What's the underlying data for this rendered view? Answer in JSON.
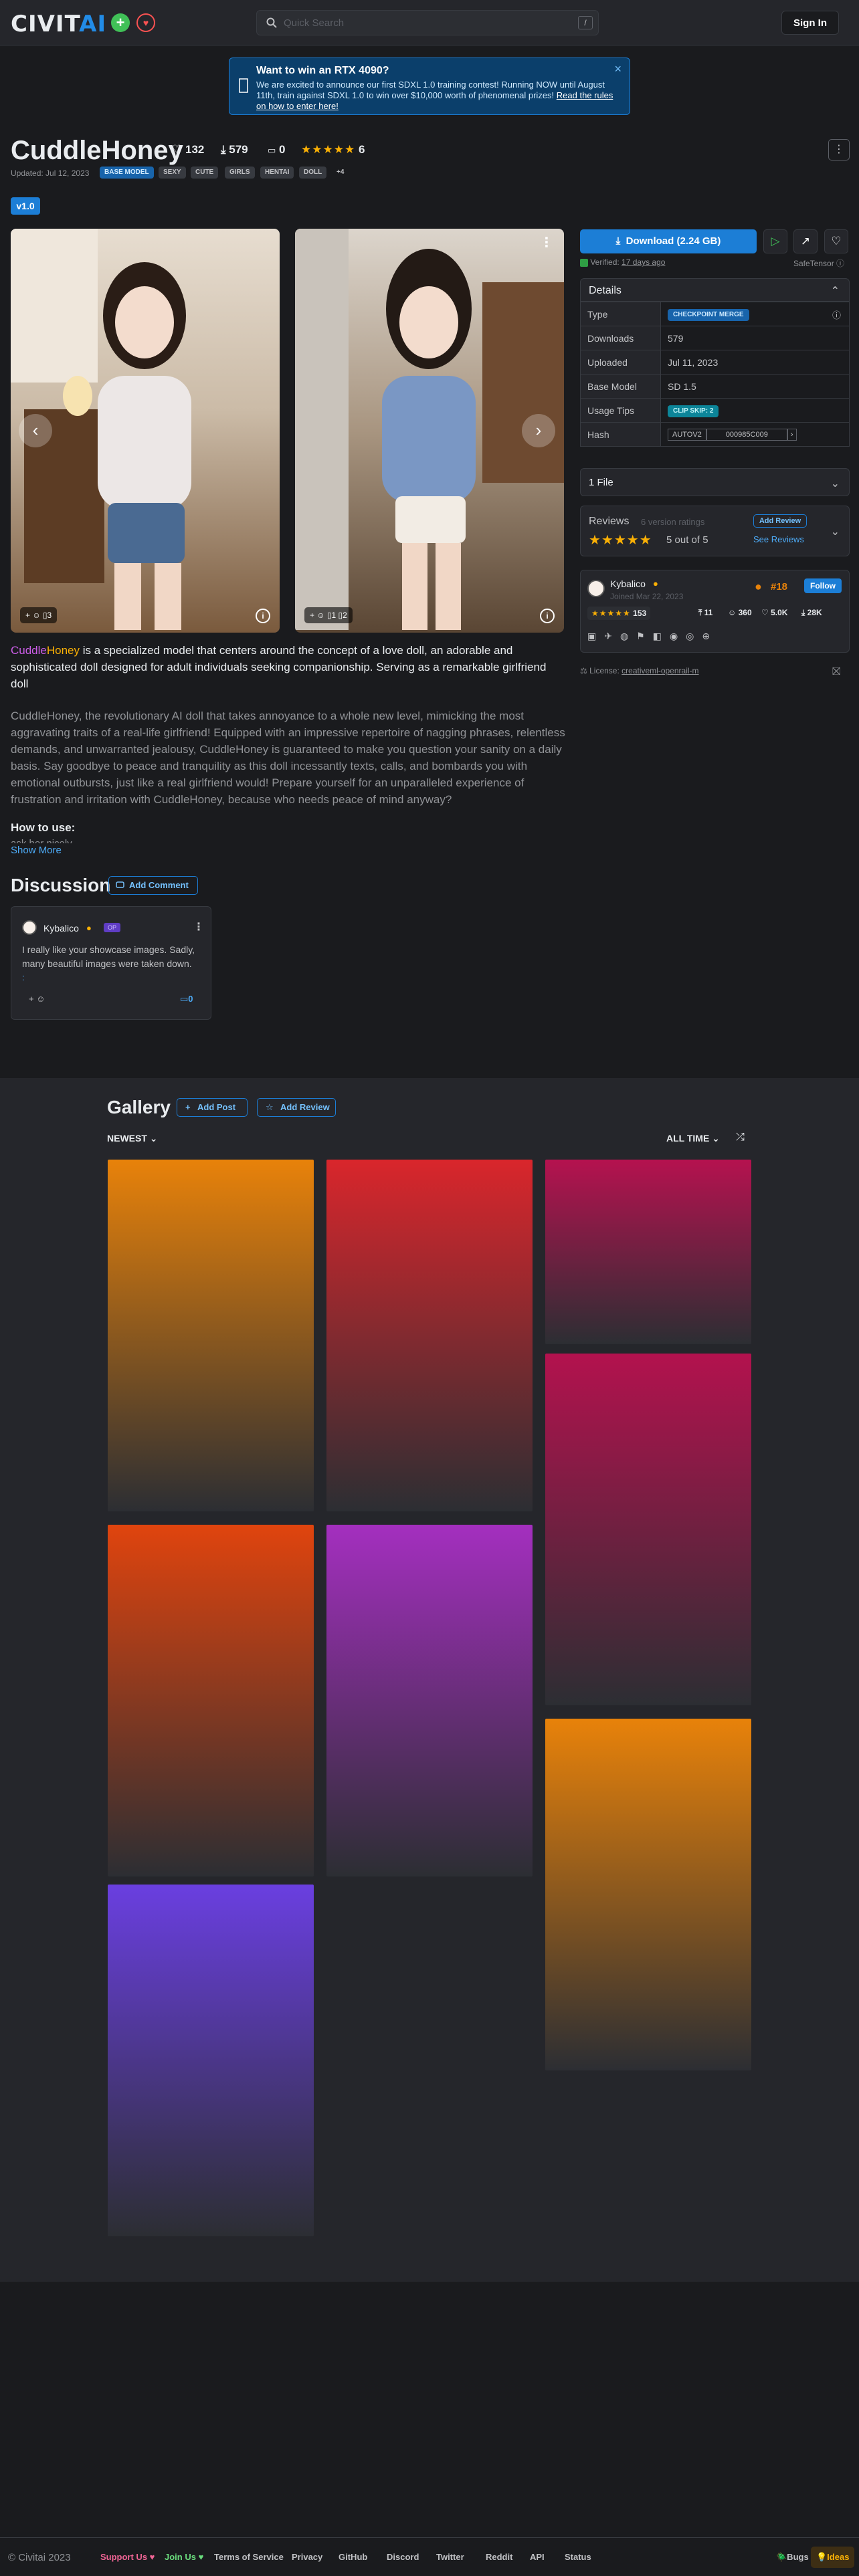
{
  "header": {
    "logo_main": "CIVIT",
    "logo_accent": "AI",
    "search_placeholder": "Quick Search",
    "search_shortcut": "/",
    "signin": "Sign In"
  },
  "alert": {
    "title": "Want to win an RTX 4090?",
    "message": "We are excited to announce our first SDXL 1.0 training contest! Running NOW until August 11th, train against SDXL 1.0 to win over $10,000 worth of phenomenal prizes!",
    "link": "Read the rules on how to enter here!",
    "close": "×"
  },
  "model": {
    "title": "CuddleHoney",
    "likes": "132",
    "downloads": "579",
    "comments": "0",
    "rating_count": "6",
    "updated": "Updated: Jul 12, 2023",
    "tags": [
      "BASE MODEL",
      "SEXY",
      "CUTE",
      "GIRLS",
      "HENTAI",
      "DOLL",
      "+4"
    ],
    "version": "v1.0",
    "stars": "★★★★★"
  },
  "images": [
    {
      "reactions": "+ ☺",
      "comments": "▯3",
      "colors": [
        "#d8cfc4",
        "#6b4e36"
      ]
    },
    {
      "reactions": "+ ☺",
      "comments": "▯1 ▯2",
      "colors": [
        "#b9b2aa",
        "#5a4634"
      ]
    }
  ],
  "description": {
    "lead_name_a": "Cuddle",
    "lead_name_b": "Honey",
    "lead_rest": " is a specialized model that centers around the concept of a love doll, an adorable and sophisticated doll designed for adult individuals seeking companionship. Serving as a remarkable girlfriend doll",
    "body": "CuddleHoney, the revolutionary AI doll that takes annoyance to a whole new level, mimicking the most aggravating traits of a real-life girlfriend! Equipped with an impressive repertoire of nagging phrases, relentless demands, and unwarranted jealousy, CuddleHoney is guaranteed to make you question your sanity on a daily basis. Say goodbye to peace and tranquility as this doll incessantly texts, calls, and bombards you with emotional outbursts, just like a real girlfriend would! Prepare yourself for an unparalleled experience of frustration and irritation with CuddleHoney, because who needs peace of mind anyway?",
    "howto_title": "How to use:",
    "howto_text": "ask her nicely",
    "show_more": "Show More"
  },
  "discussion": {
    "title": "Discussion",
    "add_comment": "Add Comment",
    "comment": {
      "user": "Kybalico",
      "badge": "OP",
      "text": "I really like your showcase images. Sadly, many beautiful images were taken down.",
      "ellipsis": ":",
      "reply_count": "0"
    }
  },
  "sidebar": {
    "download": "Download (2.24 GB)",
    "verified": "Verified:",
    "verified_when": "17 days ago",
    "safetensor": "SafeTensor",
    "details_title": "Details",
    "details": [
      {
        "key": "Type",
        "value": "CHECKPOINT MERGE"
      },
      {
        "key": "Downloads",
        "value": "579"
      },
      {
        "key": "Uploaded",
        "value": "Jul 11, 2023"
      },
      {
        "key": "Base Model",
        "value": "SD 1.5"
      },
      {
        "key": "Usage Tips",
        "value": "CLIP SKIP: 2"
      },
      {
        "key": "Hash",
        "value_a": "AUTOV2",
        "value_b": "000985C009"
      }
    ],
    "files": "1 File",
    "reviews": {
      "title": "Reviews",
      "sub": "6 version ratings",
      "stars": "★★★★★",
      "score": "5 out of 5",
      "add": "Add Review",
      "see": "See Reviews"
    },
    "creator": {
      "name": "Kybalico",
      "joined": "Joined Mar 22, 2023",
      "rank": "#18",
      "follow": "Follow",
      "rating": "153",
      "stats": [
        "11",
        "360",
        "5.0K",
        "28K"
      ]
    },
    "license": "License:",
    "license_link": "creativeml-openrail-m"
  },
  "gallery": {
    "title": "Gallery",
    "add_post": "Add Post",
    "add_review": "Add Review",
    "sort": "NEWEST",
    "period": "ALL TIME",
    "tiles": [
      {
        "color": "#e8820a"
      },
      {
        "color": "#d9262c"
      },
      {
        "color": "#b5124f"
      },
      {
        "color": "#b3124e"
      },
      {
        "color": "#e0440e"
      },
      {
        "color": "#a42fbf"
      },
      {
        "color": "#e8820a"
      },
      {
        "color": "#6a3fe0"
      }
    ]
  },
  "footer": {
    "copyright": "© Civitai 2023",
    "links": [
      "Support Us ♥",
      "Join Us ♥",
      "Terms of Service",
      "Privacy",
      "GitHub",
      "Discord",
      "Twitter",
      "Reddit",
      "API",
      "Status"
    ],
    "bugs": "🪲Bugs",
    "ideas": "💡Ideas"
  }
}
